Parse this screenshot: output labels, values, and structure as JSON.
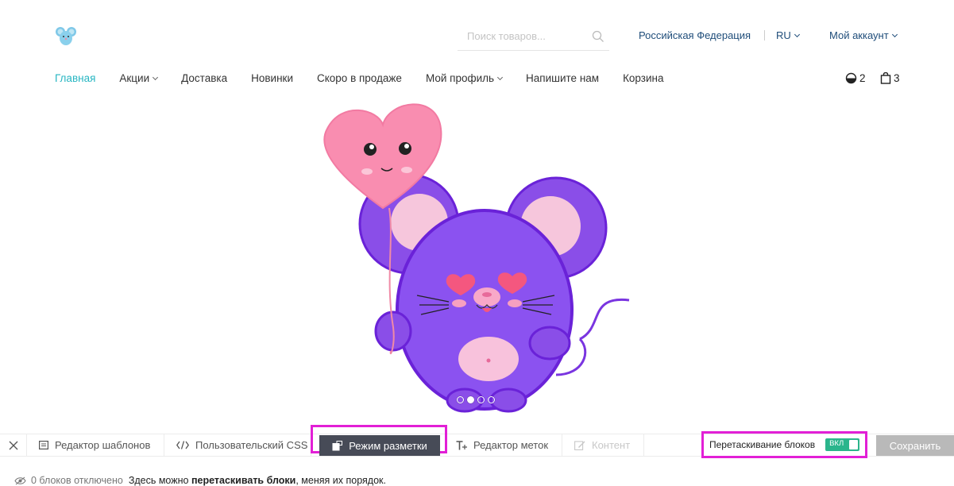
{
  "header": {
    "search_placeholder": "Поиск товаров...",
    "region": "Российская Федерация",
    "lang": "RU",
    "account": "Мой аккаунт"
  },
  "nav": {
    "items": [
      {
        "label": "Главная"
      },
      {
        "label": "Акции"
      },
      {
        "label": "Доставка"
      },
      {
        "label": "Новинки"
      },
      {
        "label": "Скоро в продаже"
      },
      {
        "label": "Мой профиль"
      },
      {
        "label": "Напишите нам"
      },
      {
        "label": "Корзина"
      }
    ],
    "compare_count": "2",
    "cart_count": "3"
  },
  "slider": {
    "slide_count": 4,
    "active_index": 1
  },
  "toolbar": {
    "template_editor": "Редактор шаблонов",
    "custom_css": "Пользовательский CSS",
    "layout_mode": "Режим разметки",
    "label_editor": "Редактор меток",
    "content": "Контент",
    "drag_blocks_label": "Перетаскивание блоков",
    "drag_toggle_state": "ВКЛ",
    "save": "Сохранить"
  },
  "status": {
    "disabled_count": "0 блоков отключено",
    "hint_prefix": "Здесь можно",
    "hint_bold": "перетаскивать блоки",
    "hint_suffix": ", меняя их порядок."
  },
  "colors": {
    "accent": "#27b6c2",
    "highlight": "#e21fd6",
    "toggle_on": "#2bb58c",
    "active_tab_bg": "#474b57"
  }
}
